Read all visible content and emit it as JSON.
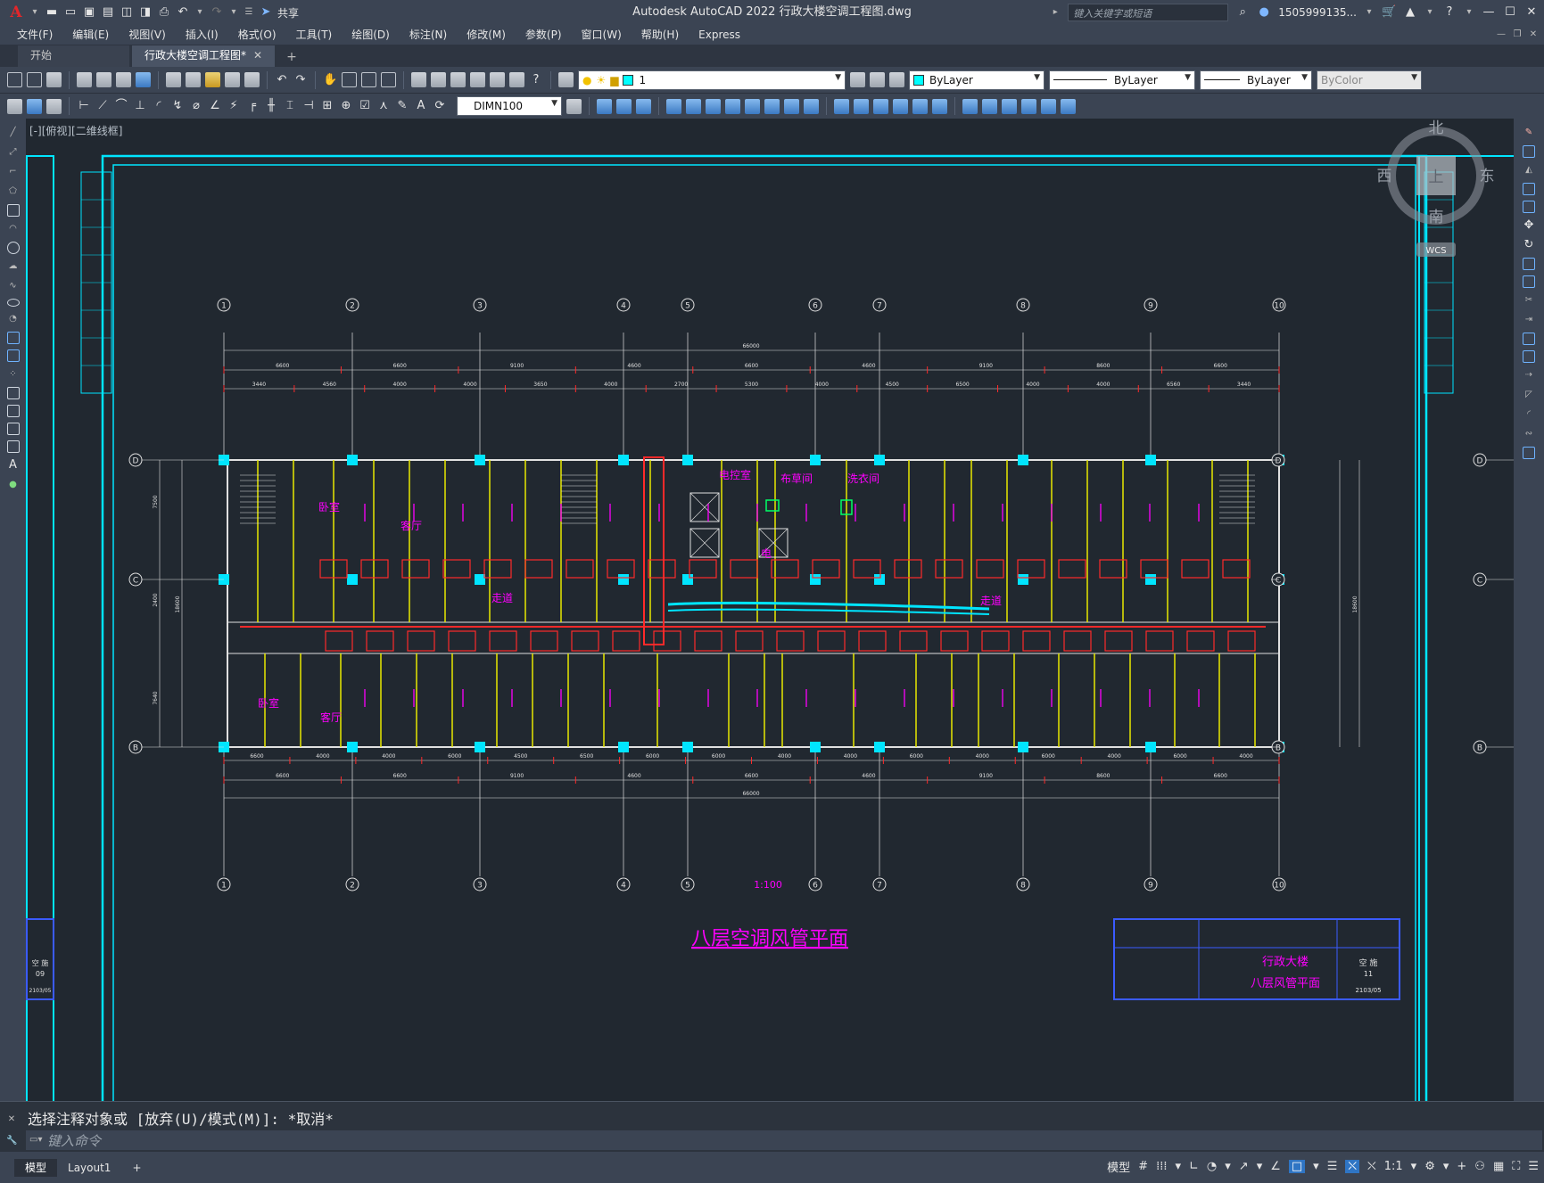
{
  "window": {
    "title": "Autodesk AutoCAD 2022    行政大楼空调工程图.dwg",
    "share_label": "共享",
    "search_placeholder": "键入关键字或短语",
    "user": "1505999135...",
    "logo": "A"
  },
  "menu": [
    "文件(F)",
    "编辑(E)",
    "视图(V)",
    "插入(I)",
    "格式(O)",
    "工具(T)",
    "绘图(D)",
    "标注(N)",
    "修改(M)",
    "参数(P)",
    "窗口(W)",
    "帮助(H)",
    "Express"
  ],
  "tabs": [
    {
      "label": "开始"
    },
    {
      "label": "行政大楼空调工程图*"
    }
  ],
  "toolbar": {
    "layer_value": "1",
    "color_value": "ByLayer",
    "linetype_value": "ByLayer",
    "lineweight_value": "ByLayer",
    "plotstyle_value": "ByColor",
    "dimstyle_value": "DIMN100"
  },
  "viewport": {
    "label": "[-][俯视][二维线框]"
  },
  "viewcube": {
    "north": "北",
    "south": "南",
    "east": "东",
    "west": "西",
    "top": "上",
    "wcs": "WCS"
  },
  "drawing": {
    "title": "八层空调风管平面",
    "scale": "1:100",
    "axis_labels": [
      "1",
      "2",
      "3",
      "4",
      "5",
      "6",
      "7",
      "8",
      "9",
      "10"
    ],
    "row_labels": [
      "D",
      "C",
      "B"
    ],
    "total_dim": "66000",
    "top_dims_a": [
      "6600",
      "6600",
      "9100",
      "4600",
      "6600",
      "4600",
      "9100",
      "8600",
      "6600"
    ],
    "top_dims_b": [
      "3440",
      "4560",
      "4000",
      "4000",
      "3650",
      "4000",
      "2700",
      "5300",
      "4000",
      "4500",
      "6500",
      "4000",
      "4000",
      "6560",
      "3440"
    ],
    "bottom_dims_a": [
      "6600",
      "6600",
      "9100",
      "4600",
      "6600",
      "4600",
      "9100",
      "8600",
      "6600"
    ],
    "bottom_dims_b": [
      "6600",
      "4000",
      "4000",
      "6000",
      "4500",
      "6500",
      "6000",
      "6000",
      "4000",
      "4000",
      "6000",
      "4000",
      "6000",
      "4000",
      "6000",
      "4000"
    ],
    "side_dims": [
      "7500",
      "2400",
      "7640",
      "18600"
    ],
    "rooms": [
      "卧室",
      "客厅",
      "走道",
      "走道",
      "卧室",
      "客厅",
      "电控室",
      "布草间",
      "洗衣间",
      "电"
    ],
    "titleblock": {
      "project": "行政大楼",
      "sheet_title": "八层风管平面",
      "left_sheet_no": "09",
      "left_date": "2103/05",
      "right_sheet_no": "11",
      "right_date": "2103/05",
      "kong": "空 施"
    }
  },
  "command": {
    "history": "选择注释对象或 [放弃(U)/模式(M)]: *取消*",
    "placeholder": "键入命令"
  },
  "status": {
    "model_tab": "模型",
    "layout_tab": "Layout1",
    "model_label": "模型",
    "scale": "1:1"
  }
}
